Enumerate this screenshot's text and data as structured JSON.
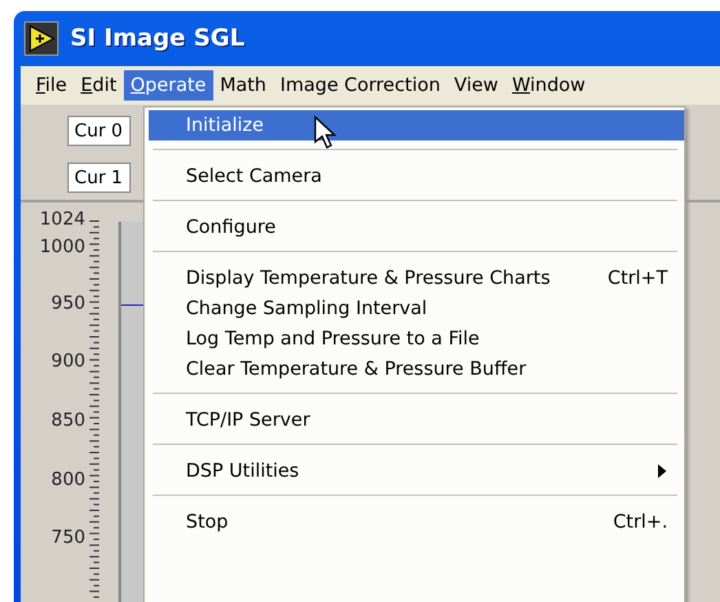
{
  "window": {
    "title": "SI Image SGL"
  },
  "menu_bar": [
    {
      "label": "File",
      "mnemonic": true,
      "selected": false
    },
    {
      "label": "Edit",
      "mnemonic": true,
      "selected": false
    },
    {
      "label": "Operate",
      "mnemonic": true,
      "selected": true
    },
    {
      "label": "Math",
      "selected": false
    },
    {
      "label": "Image Correction",
      "selected": false
    },
    {
      "label": "View",
      "selected": false
    },
    {
      "label": "Window",
      "mnemonic": true,
      "selected": false
    }
  ],
  "cursor_fields": [
    {
      "value": "Cur 0"
    },
    {
      "value": "Cur 1"
    }
  ],
  "scale": {
    "labels": [
      "1024",
      "1000",
      "950",
      "900",
      "850",
      "800",
      "750"
    ]
  },
  "dropdown": {
    "groups": [
      [
        {
          "label": "Initialize",
          "selected": true
        }
      ],
      [
        {
          "label": "Select Camera",
          "selected": false
        }
      ],
      [
        {
          "label": "Configure",
          "selected": false
        }
      ],
      [
        {
          "label": "Display Temperature & Pressure Charts",
          "shortcut": "Ctrl+T",
          "selected": false
        },
        {
          "label": "Change Sampling Interval",
          "selected": false
        },
        {
          "label": "Log Temp and Pressure to a File",
          "selected": false
        },
        {
          "label": "Clear Temperature & Pressure Buffer",
          "selected": false
        }
      ],
      [
        {
          "label": "TCP/IP Server",
          "selected": false
        }
      ],
      [
        {
          "label": "DSP Utilities",
          "submenu": true,
          "selected": false
        }
      ],
      [
        {
          "label": "Stop",
          "shortcut": "Ctrl+.",
          "selected": false
        }
      ]
    ]
  }
}
